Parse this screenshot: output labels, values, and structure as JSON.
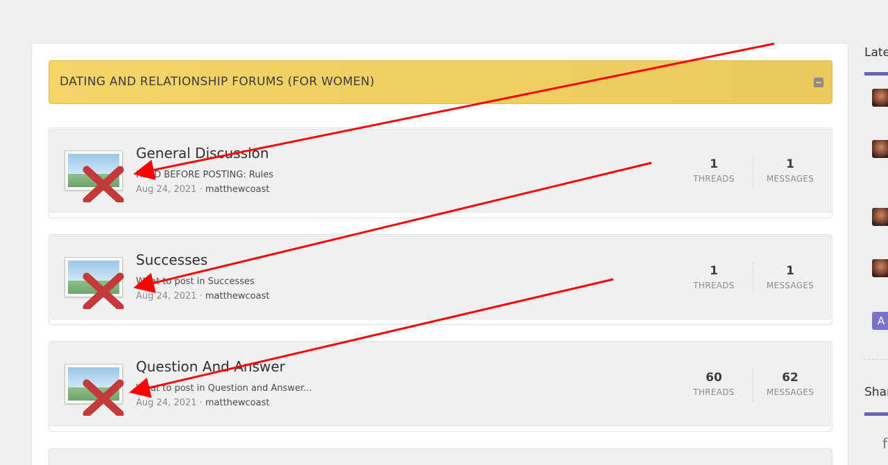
{
  "category": {
    "title": "DATING AND RELATIONSHIP FORUMS (FOR WOMEN)",
    "collapse_icon": "minus-square-icon"
  },
  "forums": [
    {
      "title": "General Discussion",
      "latest_thread": "READ BEFORE POSTING: Rules",
      "date": "Aug 24, 2021",
      "separator": "·",
      "author": "matthewcoast",
      "threads": "1",
      "threads_label": "THREADS",
      "messages": "1",
      "messages_label": "MESSAGES",
      "icon": "broken-image-icon"
    },
    {
      "title": "Successes",
      "latest_thread": "What to post in Successes",
      "date": "Aug 24, 2021",
      "separator": "·",
      "author": "matthewcoast",
      "threads": "1",
      "threads_label": "THREADS",
      "messages": "1",
      "messages_label": "MESSAGES",
      "icon": "broken-image-icon"
    },
    {
      "title": "Question And Answer",
      "latest_thread": "What to post in Question and Answer...",
      "date": "Aug 24, 2021",
      "separator": "·",
      "author": "matthewcoast",
      "threads": "60",
      "threads_label": "THREADS",
      "messages": "62",
      "messages_label": "MESSAGES",
      "icon": "broken-image-icon"
    }
  ],
  "sidebar": {
    "latest_heading": "Late",
    "share_heading": "Shar",
    "avatar_letter": "A",
    "share_icon": "facebook-icon"
  },
  "annotations": {
    "arrow_color": "#ff0000",
    "arrow_count": 3
  },
  "colors": {
    "category_bg": "#ecc95c",
    "accent": "#6b63b5",
    "node_bg": "#f0f0f0"
  }
}
